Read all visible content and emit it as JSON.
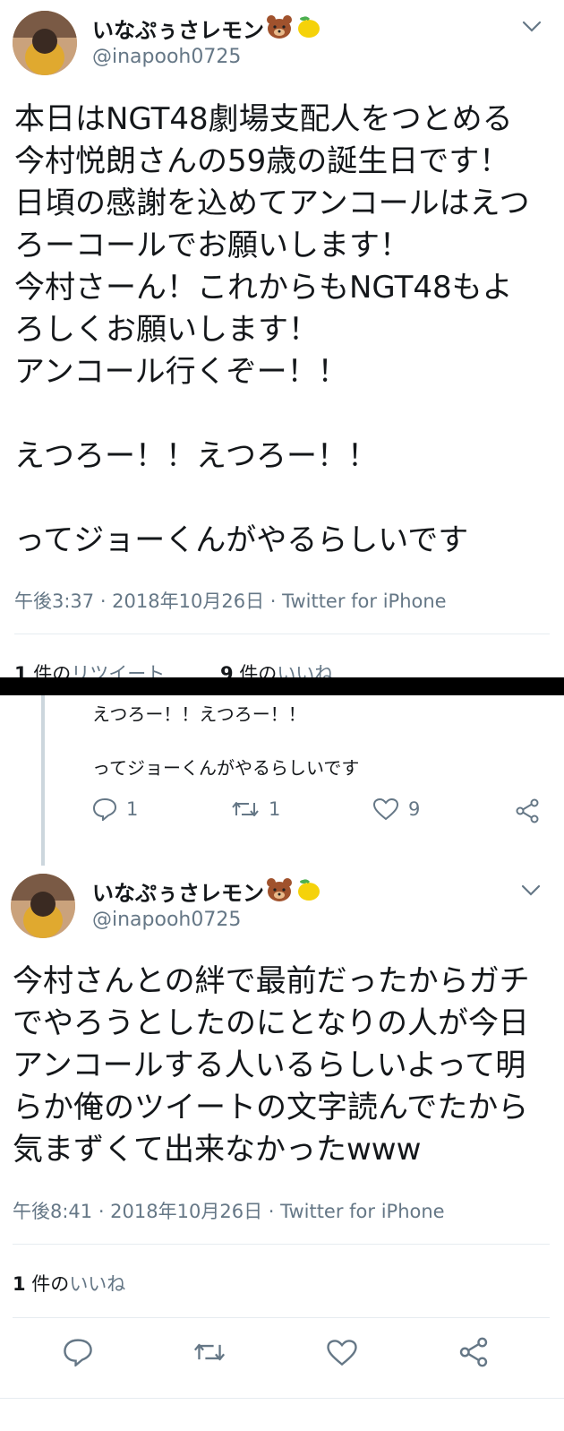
{
  "tweet1": {
    "display_name": "いなぷぅさレモン",
    "name_emoji": [
      "bear-emoji",
      "lemon-emoji"
    ],
    "handle": "@inapooh0725",
    "text": "本日はNGT48劇場支配人をつとめる\n今村悦朗さんの59歳の誕生日です！\n日頃の感謝を込めてアンコールはえつ\nろーコールでお願いします！\n今村さーん！これからもNGT48もよ\nろしくお願いします！\nアンコール行くぞー！！\n\nえつろー！！えつろー！！\n\nってジョーくんがやるらしいです",
    "meta": "午後3:37 · 2018年10月26日 · Twitter for iPhone",
    "retweet_count": "1",
    "retweet_label": " 件の",
    "retweet_link": "リツイート",
    "like_count": "9",
    "like_label": " 件の",
    "like_link": "いいね"
  },
  "tweet2_context": {
    "text": "えつろー！！えつろー！！\n\nってジョーくんがやるらしいです",
    "reply_count": "1",
    "retweet_count": "1",
    "like_count": "9"
  },
  "tweet3": {
    "display_name": "いなぷぅさレモン",
    "handle": "@inapooh0725",
    "text": "今村さんとの絆で最前だったからガチ\nでやろうとしたのにとなりの人が今日\nアンコールする人いるらしいよって明\nらか俺のツイートの文字読んでたから\n気まずくて出来なかったwww",
    "meta": "午後8:41 · 2018年10月26日 · Twitter for iPhone",
    "like_count": "1",
    "like_label": " 件の",
    "like_link": "いいね"
  },
  "colors": {
    "text": "#14171a",
    "secondary": "#657786",
    "divider": "#e6ecf0",
    "separator_bar": "#000000"
  }
}
